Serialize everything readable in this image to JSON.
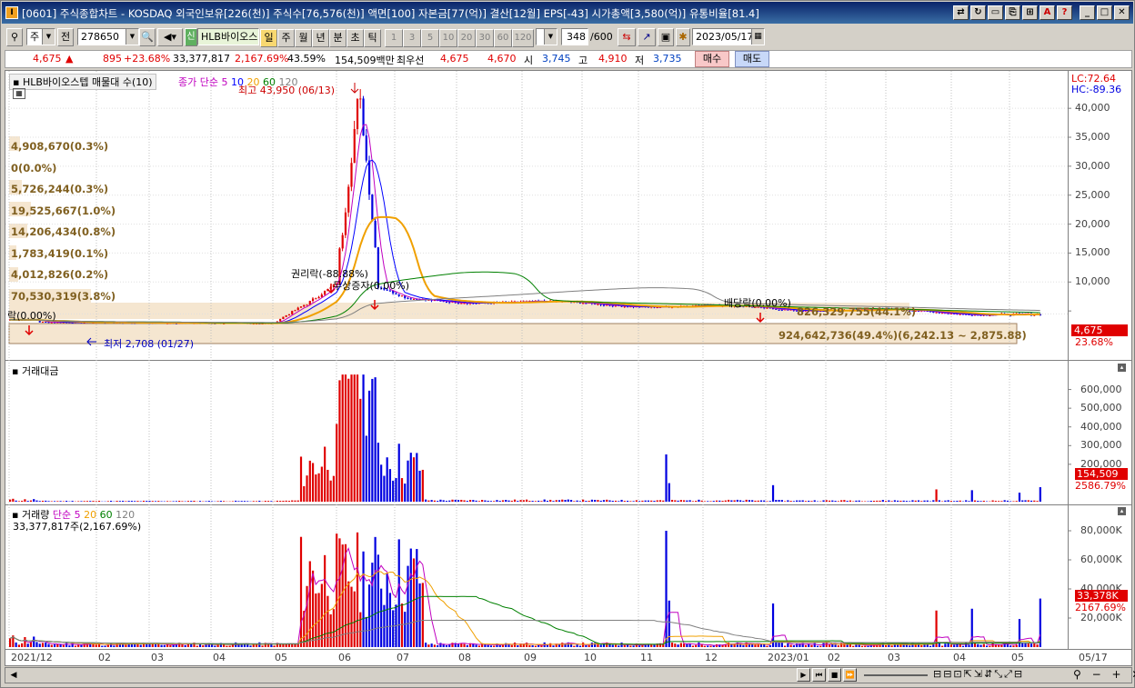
{
  "window": {
    "title": "[0601] 주식종합차트 - KOSDAQ 외국인보유[226(천)] 주식수[76,576(천)] 액면[100] 자본금[77(억)] 결산[12월] EPS[-43] 시가총액[3,580(억)] 유통비율[81.4]"
  },
  "toolbar": {
    "code_type": "주",
    "prefix": "전",
    "code": "278650",
    "stock_name": "HLB바이오스",
    "period_selected": "일",
    "periods": [
      "일",
      "주",
      "월",
      "년",
      "분",
      "초",
      "틱"
    ],
    "intervals": [
      "1",
      "3",
      "5",
      "10",
      "20",
      "30",
      "60",
      "120"
    ],
    "count": "348",
    "count_max": "/600",
    "date": "2023/05/17"
  },
  "quote": {
    "price": "4,675",
    "arrow": "▲",
    "change": "895",
    "change_pct": "+23.68%",
    "volume": "33,377,817",
    "vol_pct": "2,167.69%",
    "turnover": "43.59%",
    "amount": "154,509백만",
    "bid_label": "최우선",
    "ask": "4,675",
    "bid": "4,670",
    "open_label": "시",
    "open": "3,745",
    "high_label": "고",
    "high": "4,910",
    "low_label": "저",
    "low": "3,735",
    "buy": "매수",
    "sell": "매도"
  },
  "price_panel": {
    "title": "HLB바이오스텝 매물대 수(10)",
    "ma_label": "종가 단순",
    "ma_periods": [
      "5",
      "10",
      "20",
      "60",
      "120"
    ],
    "lc": "LC:72.64",
    "hc": "HC:-89.36",
    "high_note": "최고 43,950 (06/13)",
    "low_note": "최저 2,708 (01/27)",
    "event1": "락(0.00%)",
    "event2": "권리락(-88.88%)",
    "event3": "무상증자(0.00%)",
    "event4": "배당락(0.00%)",
    "current_price": "4,675",
    "current_pct": "23.68%",
    "y_ticks": [
      "40,000",
      "35,000",
      "30,000",
      "25,000",
      "20,000",
      "15,000",
      "10,000",
      "5,000"
    ],
    "volume_profile": [
      "4,908,670(0.3%)",
      "0(0.0%)",
      "5,726,244(0.3%)",
      "19,525,667(1.0%)",
      "14,206,434(0.8%)",
      "1,783,419(0.1%)",
      "4,012,826(0.2%)",
      "70,530,319(3.8%)",
      "826,329,755(44.1%)",
      "924,642,736(49.4%)(6,242.13 ~ 2,875.88)"
    ]
  },
  "amount_panel": {
    "title": "거래대금",
    "y_ticks": [
      "600,000",
      "500,000",
      "400,000",
      "300,000",
      "200,000"
    ],
    "current": "154,509",
    "current_pct": "2586.79%"
  },
  "volume_panel": {
    "title": "거래량",
    "ma_label": "단순",
    "ma_periods": [
      "5",
      "20",
      "60",
      "120"
    ],
    "info": "33,377,817주(2,167.69%)",
    "y_ticks": [
      "80,000K",
      "60,000K",
      "40,000K",
      "20,000K"
    ],
    "current": "33,378K",
    "current_pct": "2167.69%"
  },
  "x_axis": {
    "labels": [
      "2021/12",
      "02",
      "03",
      "04",
      "05",
      "06",
      "07",
      "08",
      "09",
      "10",
      "11",
      "12",
      "2023/01",
      "02",
      "03",
      "04",
      "05"
    ],
    "end_label": "05/17"
  },
  "colors": {
    "up": "#e00000",
    "down": "#0000e0",
    "ma5": "#c000c0",
    "ma10": "#0000ff",
    "ma20": "#f0a000",
    "ma60": "#008000",
    "ma120": "#808080",
    "profile": "#f5e6d0"
  }
}
